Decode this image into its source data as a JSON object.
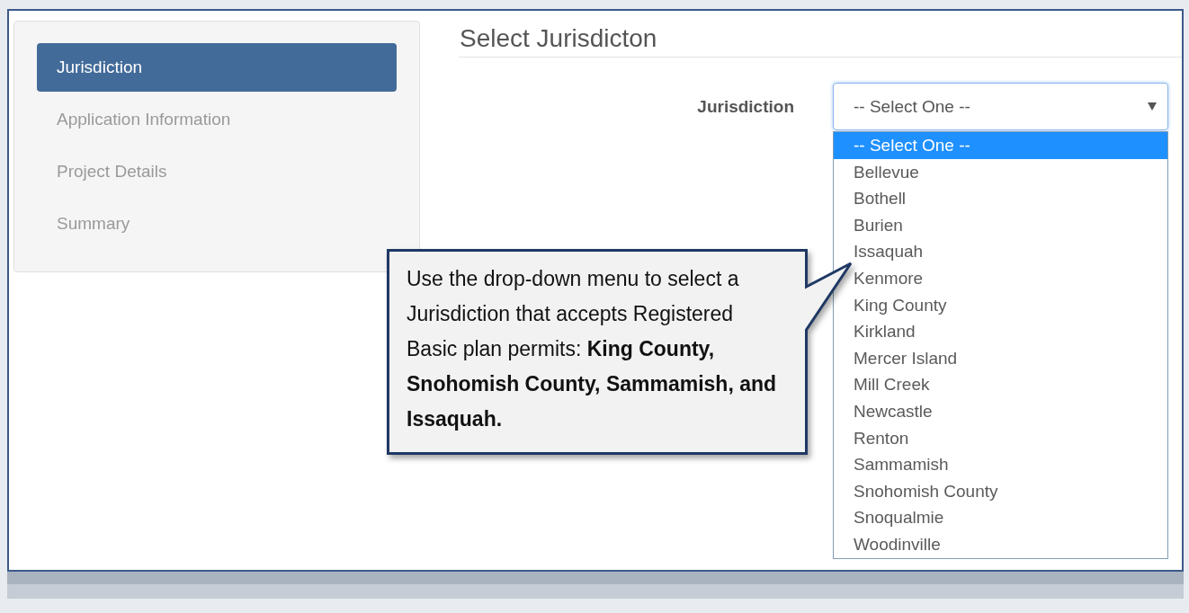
{
  "sidebar": {
    "items": [
      {
        "label": "Jurisdiction",
        "selected": true
      },
      {
        "label": "Application Information",
        "selected": false
      },
      {
        "label": "Project Details",
        "selected": false
      },
      {
        "label": "Summary",
        "selected": false
      }
    ]
  },
  "heading": "Select Jurisdicton",
  "form": {
    "label": "Jurisdiction",
    "select": {
      "value": "-- Select One --",
      "expanded": true,
      "options": [
        {
          "label": "-- Select One --",
          "selected": true
        },
        {
          "label": "Bellevue",
          "selected": false
        },
        {
          "label": "Bothell",
          "selected": false
        },
        {
          "label": "Burien",
          "selected": false
        },
        {
          "label": "Issaquah",
          "selected": false
        },
        {
          "label": "Kenmore",
          "selected": false
        },
        {
          "label": "King County",
          "selected": false
        },
        {
          "label": "Kirkland",
          "selected": false
        },
        {
          "label": "Mercer Island",
          "selected": false
        },
        {
          "label": "Mill Creek",
          "selected": false
        },
        {
          "label": "Newcastle",
          "selected": false
        },
        {
          "label": "Renton",
          "selected": false
        },
        {
          "label": "Sammamish",
          "selected": false
        },
        {
          "label": "Snohomish County",
          "selected": false
        },
        {
          "label": "Snoqualmie",
          "selected": false
        },
        {
          "label": "Woodinville",
          "selected": false
        }
      ]
    }
  },
  "callout": {
    "text": "Use the drop-down menu to select a Jurisdiction that accepts Registered Basic plan permits: **King County, Snohomish County, Sammamish, and Issaquah.**"
  }
}
